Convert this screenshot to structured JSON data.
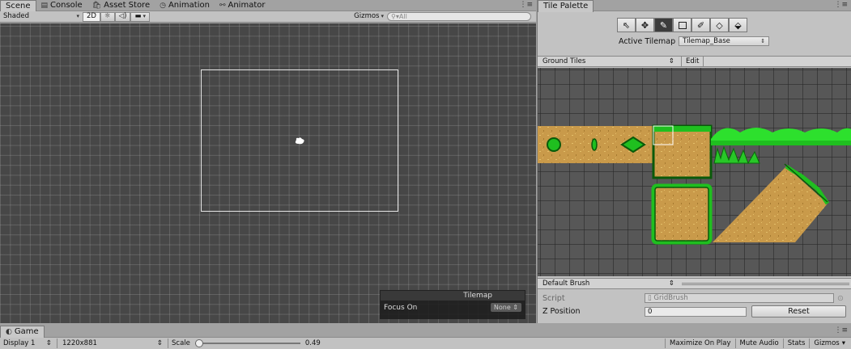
{
  "scene_tabs": [
    {
      "label": "Scene",
      "icon": "scene-icon",
      "active": true
    },
    {
      "label": "Console",
      "icon": "console-icon",
      "active": false
    },
    {
      "label": "Asset Store",
      "icon": "store-icon",
      "active": false
    },
    {
      "label": "Animation",
      "icon": "clock-icon",
      "active": false
    },
    {
      "label": "Animator",
      "icon": "animator-icon",
      "active": false
    }
  ],
  "scene_toolbar": {
    "shading_mode": "Shaded",
    "mode_2d": "2D",
    "gizmos": "Gizmos",
    "search_placeholder": "All"
  },
  "tilemap_overlay": {
    "title": "Tilemap",
    "focus_label": "Focus On",
    "focus_value": "None"
  },
  "palette": {
    "tab_label": "Tile Palette",
    "active_tilemap_label": "Active Tilemap",
    "active_tilemap_value": "Tilemap_Base",
    "palette_name": "Ground Tiles",
    "edit_label": "Edit",
    "brush_name": "Default Brush",
    "script_label": "Script",
    "script_value": "GridBrush",
    "z_position_label": "Z Position",
    "z_position_value": "0",
    "reset_label": "Reset",
    "tools": [
      "select-tool-icon",
      "move-tool-icon",
      "paint-brush-icon",
      "box-fill-icon",
      "picker-icon",
      "eraser-icon",
      "fill-icon"
    ]
  },
  "game": {
    "tab_label": "Game",
    "display": "Display 1",
    "resolution": "1220x881",
    "scale_label": "Scale",
    "scale_value": "0.49",
    "maximize": "Maximize On Play",
    "mute": "Mute Audio",
    "stats": "Stats",
    "gizmos": "Gizmos"
  },
  "colors": {
    "scene_bg": "#474747",
    "tile_dirt": "#c99a4a",
    "tile_grass": "#1fbf1f",
    "tile_edge": "#0a5a0a"
  }
}
